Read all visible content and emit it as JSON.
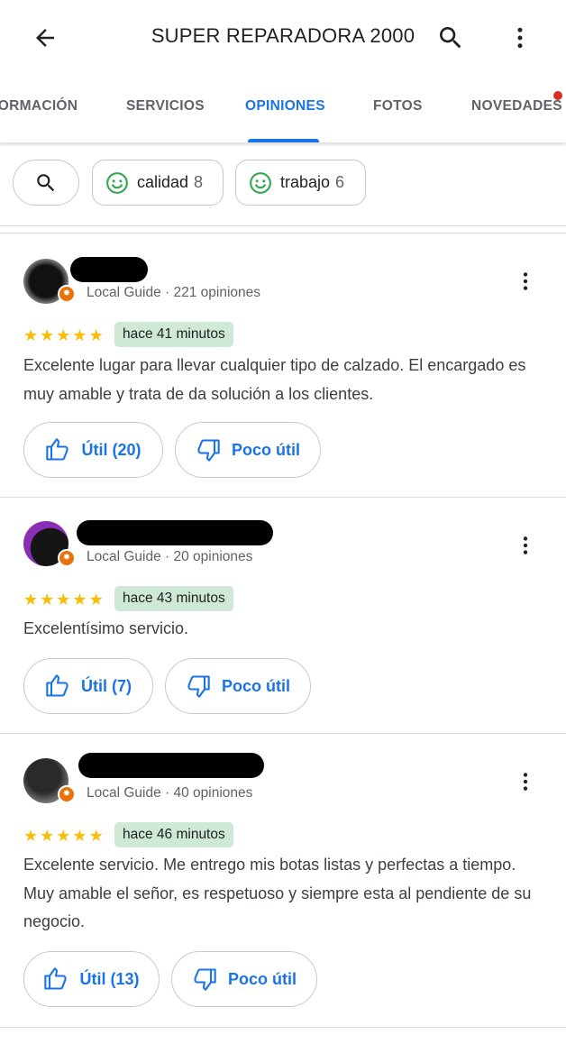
{
  "header": {
    "title": "SUPER REPARADORA 2000",
    "back_icon": "arrow-left-icon",
    "search_icon": "search-icon",
    "more_icon": "more-vert-icon"
  },
  "tabs": [
    {
      "label": "FORMACIÓN"
    },
    {
      "label": "SERVICIOS"
    },
    {
      "label": "OPINIONES",
      "active": true
    },
    {
      "label": "FOTOS"
    },
    {
      "label": "NOVEDADES",
      "has_dot": true
    }
  ],
  "filters": {
    "chips": [
      {
        "label": "calidad",
        "count": "8",
        "icon": "smile-icon"
      },
      {
        "label": "trabajo",
        "count": "6",
        "icon": "smile-icon"
      }
    ]
  },
  "colors": {
    "accent": "#1a73e8",
    "star": "#fbbc04",
    "time_pill": "#ceead6",
    "local_guide_badge": "#e8710a",
    "notification_dot": "#d93025",
    "smile": "#34a853"
  },
  "reviews": [
    {
      "meta": "Local Guide · 221 opiniones",
      "stars": 5,
      "time": "hace 41 minutos",
      "text": "Excelente lugar para llevar cualquier tipo de calzado. El encargado es muy amable y trata de da solución a los clientes.",
      "helpful_label": "Útil (20)",
      "not_helpful_label": "Poco útil"
    },
    {
      "meta": "Local Guide · 20 opiniones",
      "stars": 5,
      "time": "hace 43 minutos",
      "text": "Excelentísimo servicio.",
      "helpful_label": "Útil (7)",
      "not_helpful_label": "Poco útil"
    },
    {
      "meta": "Local Guide · 40 opiniones",
      "stars": 5,
      "time": "hace 46 minutos",
      "text": "Excelente servicio. Me entrego mis botas listas y perfectas a tiempo. Muy amable el señor, es respetuoso y siempre esta al pendiente de su negocio.",
      "helpful_label": "Útil (13)",
      "not_helpful_label": "Poco útil"
    }
  ]
}
